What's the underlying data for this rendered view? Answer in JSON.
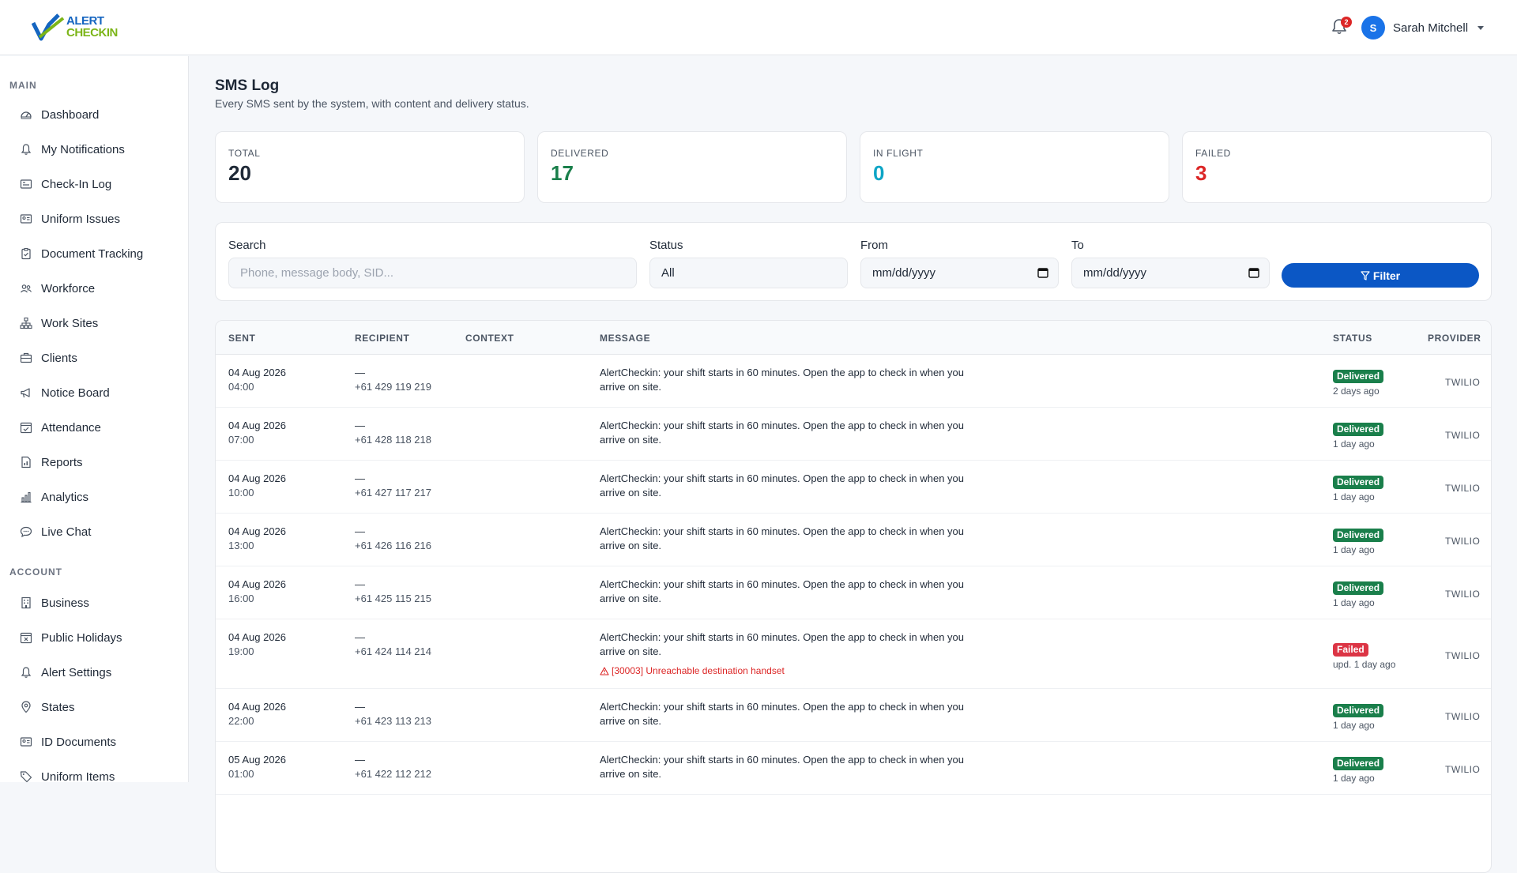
{
  "brand": {
    "line1": "ALERT",
    "line2": "CHECKIN"
  },
  "header": {
    "notification_count": "2",
    "user_initial": "S",
    "user_name": "Sarah Mitchell"
  },
  "sidebar": {
    "main_label": "MAIN",
    "main_items": [
      {
        "label": "Dashboard",
        "icon": "gauge-icon"
      },
      {
        "label": "My Notifications",
        "icon": "bell-icon"
      },
      {
        "label": "Check-In Log",
        "icon": "log-icon"
      },
      {
        "label": "Uniform Issues",
        "icon": "id-card-icon"
      },
      {
        "label": "Document Tracking",
        "icon": "clipboard-icon"
      },
      {
        "label": "Workforce",
        "icon": "people-icon"
      },
      {
        "label": "Work Sites",
        "icon": "sitemap-icon"
      },
      {
        "label": "Clients",
        "icon": "briefcase-icon"
      },
      {
        "label": "Notice Board",
        "icon": "megaphone-icon"
      },
      {
        "label": "Attendance",
        "icon": "calendar-check-icon"
      },
      {
        "label": "Reports",
        "icon": "report-icon"
      },
      {
        "label": "Analytics",
        "icon": "bar-chart-icon"
      },
      {
        "label": "Live Chat",
        "icon": "chat-icon"
      }
    ],
    "account_label": "ACCOUNT",
    "account_items": [
      {
        "label": "Business",
        "icon": "building-icon"
      },
      {
        "label": "Public Holidays",
        "icon": "calendar-x-icon"
      },
      {
        "label": "Alert Settings",
        "icon": "bell-icon"
      },
      {
        "label": "States",
        "icon": "map-pin-icon"
      },
      {
        "label": "ID Documents",
        "icon": "id-card-icon"
      },
      {
        "label": "Uniform Items",
        "icon": "tag-icon"
      }
    ]
  },
  "page": {
    "title": "SMS Log",
    "subtitle": "Every SMS sent by the system, with content and delivery status."
  },
  "stats": [
    {
      "label": "TOTAL",
      "value": "20",
      "color": "#1f2937"
    },
    {
      "label": "DELIVERED",
      "value": "17",
      "color": "#1a7f4b"
    },
    {
      "label": "IN FLIGHT",
      "value": "0",
      "color": "#0ea5c6"
    },
    {
      "label": "FAILED",
      "value": "3",
      "color": "#dc2626"
    }
  ],
  "filters": {
    "search_label": "Search",
    "search_placeholder": "Phone, message body, SID...",
    "status_label": "Status",
    "status_value": "All",
    "from_label": "From",
    "from_value": "mm/dd/yyyy",
    "to_label": "To",
    "to_value": "mm/dd/yyyy",
    "filter_button": "Filter"
  },
  "table": {
    "columns": [
      "SENT",
      "RECIPIENT",
      "CONTEXT",
      "MESSAGE",
      "STATUS",
      "PROVIDER"
    ],
    "rows": [
      {
        "date": "04 Aug 2026",
        "time": "04:00",
        "recipient_name": "—",
        "phone": "+61 429 119 219",
        "context": "",
        "message": "AlertCheckin: your shift starts in 60 minutes. Open the app to check in when you arrive on site.",
        "error": "",
        "status": "Delivered",
        "status_sub": "2 days ago",
        "provider": "TWILIO"
      },
      {
        "date": "04 Aug 2026",
        "time": "07:00",
        "recipient_name": "—",
        "phone": "+61 428 118 218",
        "context": "",
        "message": "AlertCheckin: your shift starts in 60 minutes. Open the app to check in when you arrive on site.",
        "error": "",
        "status": "Delivered",
        "status_sub": "1 day ago",
        "provider": "TWILIO"
      },
      {
        "date": "04 Aug 2026",
        "time": "10:00",
        "recipient_name": "—",
        "phone": "+61 427 117 217",
        "context": "",
        "message": "AlertCheckin: your shift starts in 60 minutes. Open the app to check in when you arrive on site.",
        "error": "",
        "status": "Delivered",
        "status_sub": "1 day ago",
        "provider": "TWILIO"
      },
      {
        "date": "04 Aug 2026",
        "time": "13:00",
        "recipient_name": "—",
        "phone": "+61 426 116 216",
        "context": "",
        "message": "AlertCheckin: your shift starts in 60 minutes. Open the app to check in when you arrive on site.",
        "error": "",
        "status": "Delivered",
        "status_sub": "1 day ago",
        "provider": "TWILIO"
      },
      {
        "date": "04 Aug 2026",
        "time": "16:00",
        "recipient_name": "—",
        "phone": "+61 425 115 215",
        "context": "",
        "message": "AlertCheckin: your shift starts in 60 minutes. Open the app to check in when you arrive on site.",
        "error": "",
        "status": "Delivered",
        "status_sub": "1 day ago",
        "provider": "TWILIO"
      },
      {
        "date": "04 Aug 2026",
        "time": "19:00",
        "recipient_name": "—",
        "phone": "+61 424 114 214",
        "context": "",
        "message": "AlertCheckin: your shift starts in 60 minutes. Open the app to check in when you arrive on site.",
        "error": "[30003] Unreachable destination handset",
        "status": "Failed",
        "status_sub": "upd. 1 day ago",
        "provider": "TWILIO"
      },
      {
        "date": "04 Aug 2026",
        "time": "22:00",
        "recipient_name": "—",
        "phone": "+61 423 113 213",
        "context": "",
        "message": "AlertCheckin: your shift starts in 60 minutes. Open the app to check in when you arrive on site.",
        "error": "",
        "status": "Delivered",
        "status_sub": "1 day ago",
        "provider": "TWILIO"
      },
      {
        "date": "05 Aug 2026",
        "time": "01:00",
        "recipient_name": "—",
        "phone": "+61 422 112 212",
        "context": "",
        "message": "AlertCheckin: your shift starts in 60 minutes. Open the app to check in when you arrive on site.",
        "error": "",
        "status": "Delivered",
        "status_sub": "1 day ago",
        "provider": "TWILIO"
      }
    ]
  }
}
